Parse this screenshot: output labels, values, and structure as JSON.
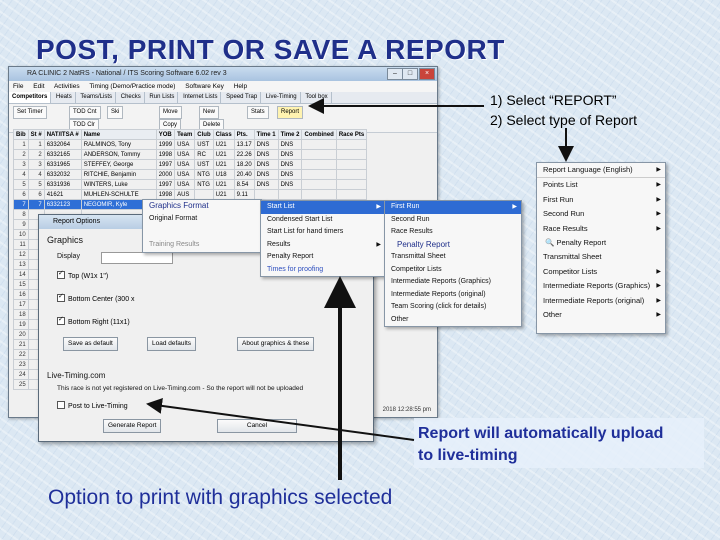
{
  "slide": {
    "title": "POST, PRINT OR SAVE A REPORT",
    "steps": [
      "1)  Select “REPORT”",
      "2)  Select type of Report"
    ],
    "note_upload": [
      "Report will automatically upload",
      "to live-timing"
    ],
    "note_graphics": "Option to print with graphics selected"
  },
  "window": {
    "title": "RA CLINIC 2 NatRS - National / ITS Scoring Software 6.02 rev 3",
    "menu": [
      "File",
      "Edit",
      "Activities",
      "Timing (Demo/Practice mode)",
      "Software Key",
      "Help"
    ],
    "tabs": [
      "Competitors",
      "Heats",
      "Teams/Lists",
      "Checks",
      "Run Lists",
      "Internet Lists",
      "Speed Trap",
      "Live-Timing",
      "Tool box"
    ],
    "toolbar": [
      "Set Timer",
      "Ski",
      "Stats",
      "Report",
      "TOD Cnt",
      "TOD Clr",
      "Move",
      "Copy",
      "New",
      "Delete"
    ],
    "columns": [
      "Bib",
      "St #",
      "NAT/ITSA #",
      "Name",
      "YOB",
      "Team",
      "Club",
      "Class",
      "Pts.",
      "Time 1",
      "Time 2",
      "Combined",
      "Race Pts"
    ],
    "rows": [
      [
        "1",
        "1",
        "6332064",
        "RALMINOS, Tony",
        "1999",
        "USA",
        "UST",
        "U21",
        "13.17",
        "DNS",
        "DNS",
        "",
        ""
      ],
      [
        "2",
        "2",
        "6332165",
        "ANDERSON, Tommy",
        "1998",
        "USA",
        "RC",
        "U21",
        "22.26",
        "DNS",
        "DNS",
        "",
        ""
      ],
      [
        "3",
        "3",
        "6331965",
        "STEFFEY, George",
        "1997",
        "USA",
        "UST",
        "U21",
        "18.20",
        "DNS",
        "DNS",
        "",
        ""
      ],
      [
        "4",
        "4",
        "6332032",
        "RITCHIE, Benjamin",
        "2000",
        "USA",
        "NTG",
        "U18",
        "20.40",
        "DNS",
        "DNS",
        "",
        ""
      ],
      [
        "5",
        "5",
        "6331936",
        "WINTERS, Luke",
        "1997",
        "USA",
        "NTG",
        "U21",
        "8.54",
        "DNS",
        "DNS",
        "",
        ""
      ],
      [
        "6",
        "6",
        "41621",
        "MUHLEN-SCHULTE",
        "1998",
        "AUS",
        "",
        "U21",
        "9.11",
        "",
        "",
        "",
        ""
      ],
      [
        "7",
        "7",
        "6332123",
        "NEGOMIR, Kyle",
        "1998",
        "USA",
        "",
        "",
        "",
        "",
        "",
        "",
        ""
      ],
      [
        "8",
        "",
        "",
        "",
        "",
        "",
        "",
        "",
        "",
        "",
        "",
        "",
        ""
      ],
      [
        "9",
        "",
        "",
        "",
        "",
        "",
        "",
        "",
        "",
        "",
        "",
        "",
        ""
      ],
      [
        "10",
        "",
        "",
        "",
        "",
        "",
        "",
        "",
        "",
        "",
        "",
        "",
        ""
      ],
      [
        "11",
        "",
        "",
        "",
        "",
        "",
        "",
        "",
        "",
        "",
        "",
        "",
        ""
      ],
      [
        "12",
        "",
        "",
        "",
        "",
        "",
        "",
        "",
        "",
        "",
        "",
        "",
        ""
      ],
      [
        "13",
        "",
        "",
        "",
        "",
        "",
        "",
        "",
        "",
        "",
        "",
        "",
        ""
      ],
      [
        "14",
        "",
        "",
        "",
        "",
        "",
        "",
        "",
        "",
        "",
        "",
        "",
        ""
      ],
      [
        "15",
        "",
        "",
        "",
        "",
        "",
        "",
        "",
        "",
        "",
        "",
        "",
        ""
      ],
      [
        "16",
        "",
        "",
        "",
        "",
        "",
        "",
        "",
        "",
        "",
        "",
        "",
        ""
      ],
      [
        "17",
        "",
        "",
        "",
        "",
        "",
        "",
        "",
        "",
        "",
        "",
        "",
        ""
      ],
      [
        "18",
        "",
        "",
        "",
        "",
        "",
        "",
        "",
        "",
        "",
        "",
        "",
        ""
      ],
      [
        "19",
        "",
        "",
        "",
        "",
        "",
        "",
        "",
        "",
        "",
        "",
        "",
        ""
      ],
      [
        "20",
        "",
        "",
        "",
        "",
        "",
        "",
        "",
        "",
        "",
        "",
        "",
        ""
      ],
      [
        "21",
        "",
        "",
        "",
        "",
        "",
        "",
        "",
        "",
        "",
        "",
        "",
        ""
      ],
      [
        "22",
        "",
        "",
        "",
        "",
        "",
        "",
        "",
        "",
        "",
        "",
        "",
        ""
      ],
      [
        "23",
        "",
        "",
        "",
        "",
        "",
        "",
        "",
        "",
        "",
        "",
        "",
        ""
      ],
      [
        "24",
        "",
        "",
        "",
        "",
        "",
        "",
        "",
        "",
        "",
        "",
        "",
        ""
      ],
      [
        "25",
        "",
        "",
        "",
        "",
        "",
        "",
        "",
        "",
        "",
        "",
        "",
        ""
      ]
    ],
    "status": "2018 12:28:55 pm"
  },
  "report_options": {
    "title": "Report Options",
    "group_graphics": "Graphics",
    "display_label": "Display",
    "checks": [
      {
        "label": "Top (W1x 1\")",
        "checked": true
      },
      {
        "label": "Bottom Center (300 x",
        "checked": true
      },
      {
        "label": "Bottom Right (11x1)",
        "checked": true
      }
    ],
    "save_default": "Save as default",
    "load_defaults": "Load defaults",
    "about_graphics": "About graphics & these",
    "live_timing_label": "Live-Timing.com",
    "live_timing_text": "This race is not yet registered on Live-Timing.com - So the report will not be uploaded",
    "live_timing_check": "Post to Live-Timing",
    "generate": "Generate Report",
    "cancel": "Cancel"
  },
  "graphics_menu": [
    "Graphics Format",
    "Original Format",
    "Training Results"
  ],
  "list_menu": [
    "Start List",
    "Condensed Start List",
    "Start List for hand timers",
    "Results",
    "Penalty Report",
    "Times for proofing"
  ],
  "run_menu": [
    "First Run",
    "Second Run",
    "Race Results",
    "Penalty Report",
    "Transmittal Sheet",
    "Competitor Lists",
    "Intermediate Reports (Graphics)",
    "Intermediate Reports (original)",
    "Team Scoring (click for details)",
    "Other"
  ],
  "report_menu": [
    "Report Language (English)",
    "Points List",
    "First Run",
    "Second Run",
    "Race Results",
    "Penalty Report",
    "Transmittal Sheet",
    "Competitor Lists",
    "Intermediate Reports (Graphics)",
    "Intermediate Reports (original)",
    "Other"
  ]
}
